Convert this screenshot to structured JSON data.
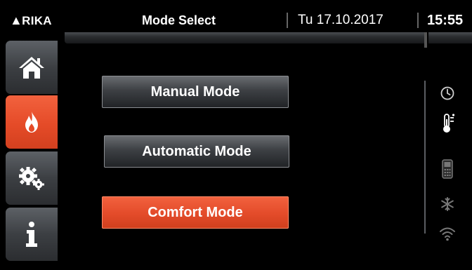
{
  "header": {
    "logo": "RIKA",
    "title": "Mode Select",
    "date": "Tu 17.10.2017",
    "time": "15:55"
  },
  "sidebar": {
    "items": [
      {
        "name": "home",
        "icon": "home-icon",
        "active": false
      },
      {
        "name": "flame",
        "icon": "flame-icon",
        "active": true
      },
      {
        "name": "settings",
        "icon": "gears-icon",
        "active": false
      },
      {
        "name": "info",
        "icon": "info-icon",
        "active": false
      }
    ]
  },
  "modes": [
    {
      "label": "Manual Mode",
      "active": false
    },
    {
      "label": "Automatic Mode",
      "active": false
    },
    {
      "label": "Comfort Mode",
      "active": true
    }
  ],
  "status_icons": [
    "clock-icon",
    "thermometer-icon",
    "remote-icon",
    "snowflake-icon",
    "wifi-icon"
  ],
  "colors": {
    "accent": "#e54b28",
    "background": "#000000",
    "button_gray": "#3d4044"
  }
}
